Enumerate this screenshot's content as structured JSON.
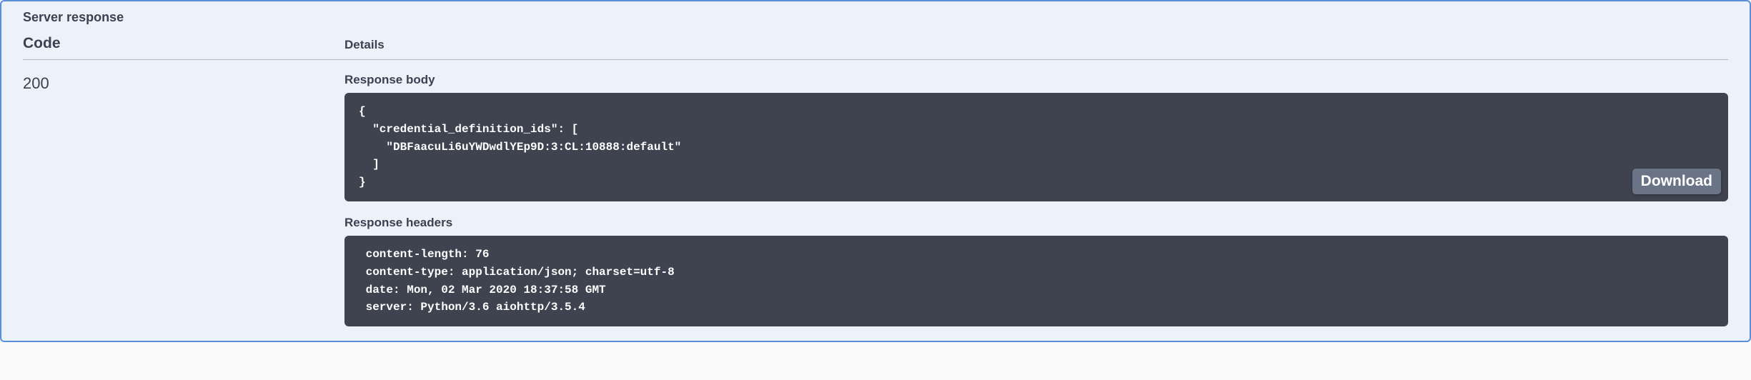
{
  "section_title": "Server response",
  "columns": {
    "code": "Code",
    "details": "Details"
  },
  "response": {
    "code": "200",
    "body_label": "Response body",
    "body_text": "{\n  \"credential_definition_ids\": [\n    \"DBFaacuLi6uYWDwdlYEp9D:3:CL:10888:default\"\n  ]\n}",
    "download_label": "Download",
    "headers_label": "Response headers",
    "headers_text": " content-length: 76 \n content-type: application/json; charset=utf-8 \n date: Mon, 02 Mar 2020 18:37:58 GMT \n server: Python/3.6 aiohttp/3.5.4 "
  }
}
